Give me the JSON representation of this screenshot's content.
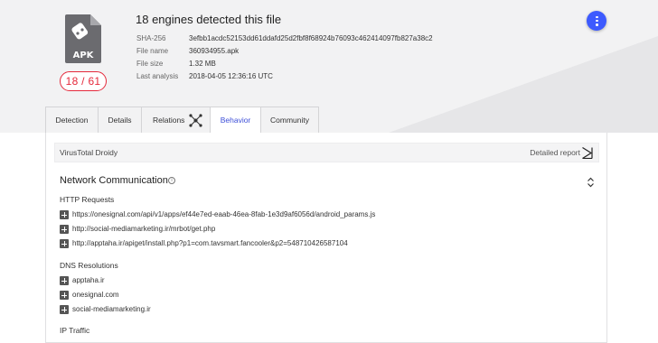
{
  "file": {
    "icon": "apk-file-icon",
    "icon_label": "APK",
    "score": "18 / 61",
    "title": "18 engines detected this file",
    "details": [
      {
        "key": "SHA-256",
        "value": "3efbb1acdc52153dd61ddafd25d2fbf8f68924b76093c462414097fb827a38c2"
      },
      {
        "key": "File name",
        "value": "360934955.apk"
      },
      {
        "key": "File size",
        "value": "1.32 MB"
      },
      {
        "key": "Last analysis",
        "value": "2018-04-05 12:36:16 UTC"
      }
    ]
  },
  "menu": {
    "icon": "more-vertical-icon"
  },
  "tabs": [
    {
      "label": "Detection"
    },
    {
      "label": "Details"
    },
    {
      "label": "Relations",
      "icon": "graph-icon"
    },
    {
      "label": "Behavior",
      "active": true
    },
    {
      "label": "Community"
    }
  ],
  "sandbox": {
    "name": "VirusTotal Droidy",
    "report_label": "Detailed report",
    "report_icon": "report-arrow-icon"
  },
  "network": {
    "title": "Network Communication",
    "info_icon": "info-icon",
    "collapse_icon": "chevron-collapse-icon",
    "http_heading": "HTTP Requests",
    "http_requests": [
      "https://onesignal.com/api/v1/apps/ef44e7ed-eaab-46ea-8fab-1e3d9af6056d/android_params.js",
      "http://social-mediamarketing.ir/mrbot/get.php",
      "http://apptaha.ir/apiget/install.php?p1=com.tavsmart.fancooler&p2=548710426587104"
    ],
    "dns_heading": "DNS Resolutions",
    "dns_resolutions": [
      "apptaha.ir",
      "onesignal.com",
      "social-mediamarketing.ir"
    ],
    "ip_heading": "IP Traffic"
  },
  "colors": {
    "accent": "#3d5afe",
    "danger": "#e5293b",
    "header_bg": "#f2f2f3"
  }
}
